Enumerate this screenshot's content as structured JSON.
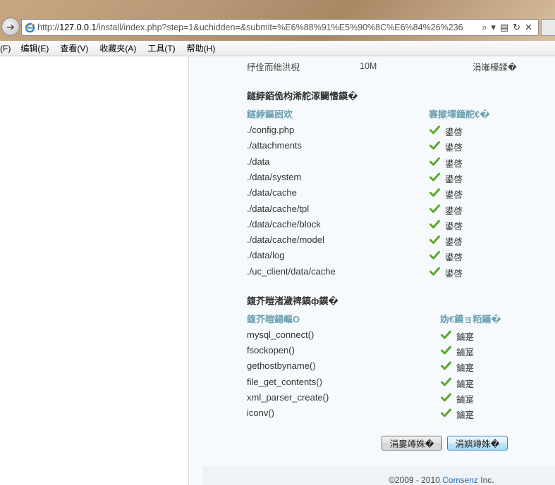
{
  "browser": {
    "url_prefix": "http://",
    "url_host": "127.0.0.1",
    "url_rest": "/install/index.php?step=1&uchidden=&submit=%E6%88%91%E5%90%8C%E6%84%26%236",
    "menu": [
      "(F)",
      "编辑(E)",
      "查看(V)",
      "收藏夹(A)",
      "工具(T)",
      "帮助(H)"
    ]
  },
  "env": {
    "label": "纾佺而绌洪棿",
    "value": "10M",
    "status": "涓嶉檺鍒�"
  },
  "dir_section": {
    "title": "鐩綍銆佹枃浠舵潈闄愭鏌�",
    "col_path": "鐩綍鏂囦欢",
    "col_status": "褰撳墠鐘舵€�",
    "items": [
      {
        "path": "./config.php",
        "status": "鍙啓"
      },
      {
        "path": "./attachments",
        "status": "鍙啓"
      },
      {
        "path": "./data",
        "status": "鍙啓"
      },
      {
        "path": "./data/system",
        "status": "鍙啓"
      },
      {
        "path": "./data/cache",
        "status": "鍙啓"
      },
      {
        "path": "./data/cache/tpl",
        "status": "鍙啓"
      },
      {
        "path": "./data/cache/block",
        "status": "鍙啓"
      },
      {
        "path": "./data/cache/model",
        "status": "鍙啓"
      },
      {
        "path": "./data/log",
        "status": "鍙啓"
      },
      {
        "path": "./uc_client/data/cache",
        "status": "鍙啓"
      }
    ]
  },
  "func_section": {
    "title": "鍑芥暟渚濊禆鎬ф鏌�",
    "col_name": "鍑芥暟鍚嶇О",
    "col_result": "妫€鏌ョ粨鏋�",
    "items": [
      {
        "name": "mysql_connect()",
        "status": "鏀寔"
      },
      {
        "name": "fsockopen()",
        "status": "鏀寔"
      },
      {
        "name": "gethostbyname()",
        "status": "鏀寔"
      },
      {
        "name": "file_get_contents()",
        "status": "鏀寔"
      },
      {
        "name": "xml_parser_create()",
        "status": "鏀寔"
      },
      {
        "name": "iconv()",
        "status": "鏀寔"
      }
    ]
  },
  "buttons": {
    "prev": "涓婁竴姝�",
    "next": "涓嬩竴姝�"
  },
  "footer": {
    "prefix": "©2009 - 2010 ",
    "brand": "Comsenz",
    "suffix": " Inc."
  },
  "colors": {
    "check": "#5aa82a",
    "column_header": "#6a9fb2",
    "content_bg": "#f7fafc"
  }
}
